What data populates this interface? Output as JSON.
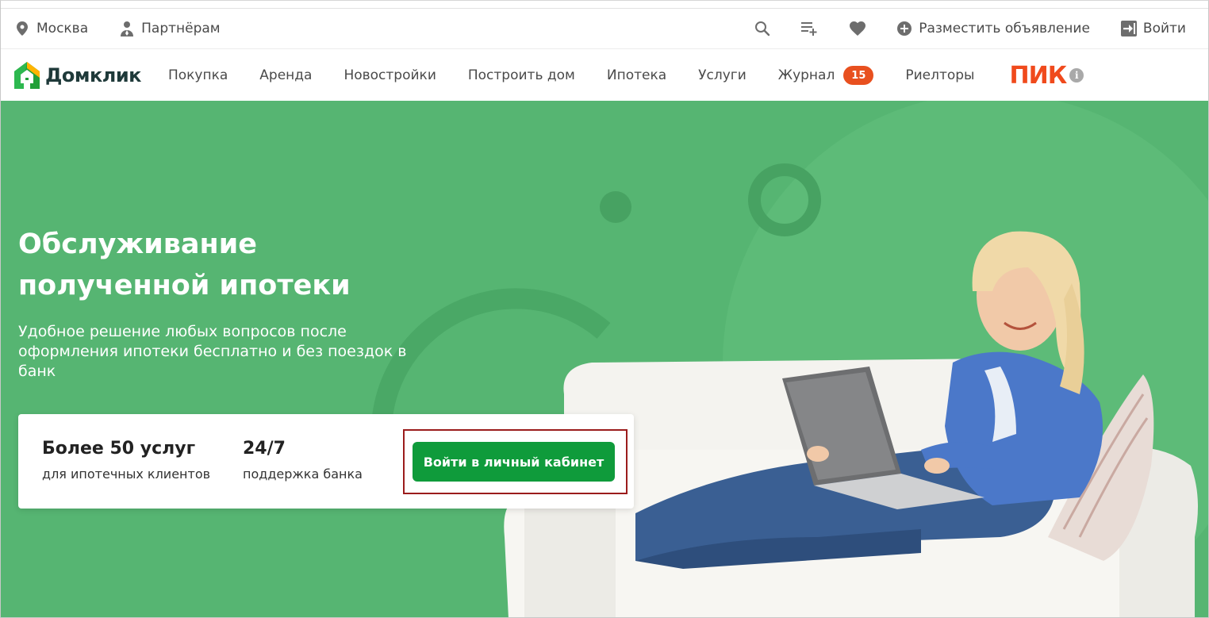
{
  "topbar": {
    "city": "Москва",
    "partners": "Партнёрам",
    "post_ad": "Разместить объявление",
    "login": "Войти"
  },
  "nav": {
    "logo_text": "Домклик",
    "items": [
      "Покупка",
      "Аренда",
      "Новостройки",
      "Построить дом",
      "Ипотека",
      "Услуги",
      "Журнал",
      "Риелторы"
    ],
    "journal_badge": "15",
    "partner_logo": "ПИК",
    "info_glyph": "i"
  },
  "hero": {
    "title_line1": "Обслуживание",
    "title_line2": "полученной ипотеки",
    "subtitle": "Удобное решение любых вопросов после оформления ипотеки бесплатно и без поездок в банк",
    "stat1_big": "Более 50 услуг",
    "stat1_small": "для ипотечных клиентов",
    "stat2_big": "24/7",
    "stat2_small": "поддержка банка",
    "login_button": "Войти в личный кабинет"
  },
  "icons": {
    "location": "location-pin-icon",
    "partners": "person-icon",
    "search": "search-icon",
    "list": "playlist-add-icon",
    "favorites": "heart-icon",
    "add": "plus-circle-icon",
    "login": "login-arrow-icon"
  },
  "colors": {
    "hero_bg": "#56b572",
    "button": "#0f9b3b",
    "badge": "#e8501f",
    "pik": "#f04a1c",
    "highlight": "#9b1c1c"
  }
}
